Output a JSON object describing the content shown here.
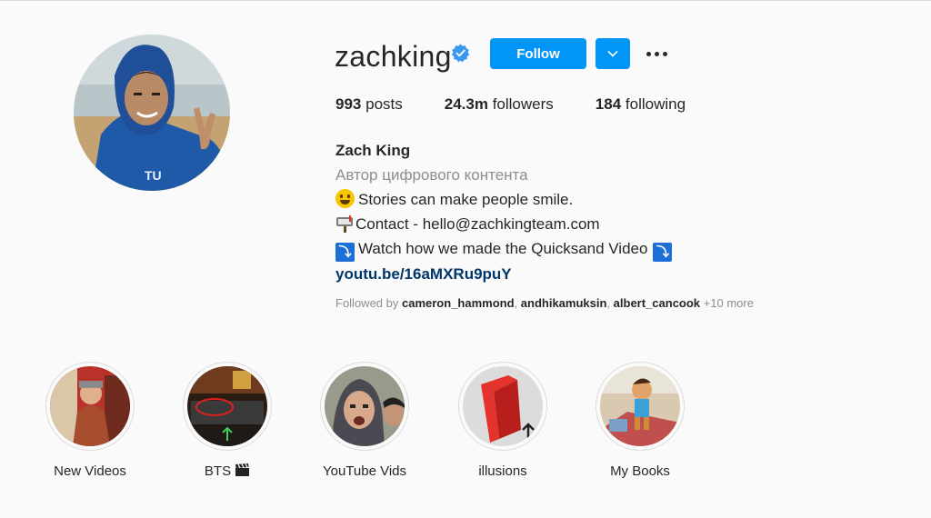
{
  "profile": {
    "username": "zachking",
    "verified": true,
    "follow_label": "Follow",
    "stats": [
      {
        "value": "993",
        "label": "posts"
      },
      {
        "value": "24.3m",
        "label": "followers"
      },
      {
        "value": "184",
        "label": "following"
      }
    ],
    "bio": {
      "name": "Zach King",
      "category": "Автор цифрового контента",
      "line1": "Stories can make people smile.",
      "line2": "Contact - hello@zachkingteam.com",
      "line3": "Watch how we made the Quicksand Video",
      "link": "youtu.be/16aMXRu9puY"
    },
    "followed_by": {
      "prefix": "Followed by",
      "users": [
        "cameron_hammond",
        "andhikamuksin",
        "albert_cancook"
      ],
      "more": "+10 more"
    }
  },
  "highlights": [
    {
      "label": "New Videos"
    },
    {
      "label": "BTS"
    },
    {
      "label": "YouTube Vids"
    },
    {
      "label": "illusions"
    },
    {
      "label": "My Books"
    }
  ],
  "colors": {
    "accent": "#0095f6",
    "verified": "#3897f0",
    "link": "#00376b",
    "muted": "#8e8e8e",
    "background": "#fafafa"
  },
  "icons": {
    "verified": "verified-badge-icon",
    "dropdown": "chevron-down-icon",
    "more": "more-options-icon",
    "smile": "smile-emoji-icon",
    "mailbox": "mailbox-emoji-icon",
    "arrow": "down-arrow-emoji-icon",
    "film": "clapper-board-icon"
  }
}
